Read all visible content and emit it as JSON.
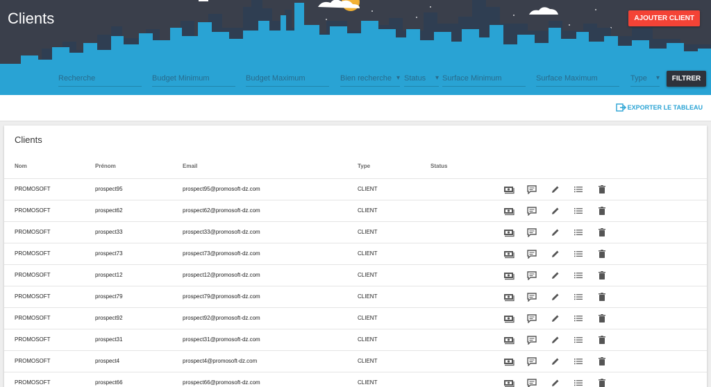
{
  "header": {
    "title": "Clients",
    "add_button": "AJOUTER CLIENT",
    "filter_button": "FILTRER",
    "filters": [
      {
        "placeholder": "Recherche",
        "type": "input"
      },
      {
        "placeholder": "Budget Minimum",
        "type": "input"
      },
      {
        "placeholder": "Budget Maximum",
        "type": "input"
      },
      {
        "placeholder": "Bien recherche",
        "type": "select"
      },
      {
        "placeholder": "Status",
        "type": "select"
      },
      {
        "placeholder": "Surface Minimum",
        "type": "input"
      },
      {
        "placeholder": "Surface Maximum",
        "type": "input"
      },
      {
        "placeholder": "Type",
        "type": "select"
      }
    ]
  },
  "toolbar": {
    "export_label": "EXPORTER LE TABLEAU"
  },
  "table": {
    "title": "Clients",
    "columns": [
      "Nom",
      "Prénom",
      "Email",
      "Type",
      "Status"
    ],
    "rows": [
      {
        "nom": "PROMOSOFT",
        "prenom": "prospect95",
        "email": "prospect95@promosoft-dz.com",
        "type": "CLIENT",
        "status": ""
      },
      {
        "nom": "PROMOSOFT",
        "prenom": "prospect62",
        "email": "prospect62@promosoft-dz.com",
        "type": "CLIENT",
        "status": ""
      },
      {
        "nom": "PROMOSOFT",
        "prenom": "prospect33",
        "email": "prospect33@promosoft-dz.com",
        "type": "CLIENT",
        "status": ""
      },
      {
        "nom": "PROMOSOFT",
        "prenom": "prospect73",
        "email": "prospect73@promosoft-dz.com",
        "type": "CLIENT",
        "status": ""
      },
      {
        "nom": "PROMOSOFT",
        "prenom": "prospect12",
        "email": "prospect12@promosoft-dz.com",
        "type": "CLIENT",
        "status": ""
      },
      {
        "nom": "PROMOSOFT",
        "prenom": "prospect79",
        "email": "prospect79@promosoft-dz.com",
        "type": "CLIENT",
        "status": ""
      },
      {
        "nom": "PROMOSOFT",
        "prenom": "prospect92",
        "email": "prospect92@promosoft-dz.com",
        "type": "CLIENT",
        "status": ""
      },
      {
        "nom": "PROMOSOFT",
        "prenom": "prospect31",
        "email": "prospect31@promosoft-dz.com",
        "type": "CLIENT",
        "status": ""
      },
      {
        "nom": "PROMOSOFT",
        "prenom": "prospect4",
        "email": "prospect4@promosoft-dz.com",
        "type": "CLIENT",
        "status": ""
      },
      {
        "nom": "PROMOSOFT",
        "prenom": "prospect66",
        "email": "prospect66@promosoft-dz.com",
        "type": "CLIENT",
        "status": ""
      }
    ],
    "row_actions": [
      "money-icon",
      "comment-icon",
      "edit-icon",
      "list-icon",
      "delete-icon"
    ]
  },
  "colors": {
    "header_sky": "#3a3f4b",
    "skyline": "#29a3d4",
    "accent_red": "#f44336",
    "filter_button": "#2e323b",
    "link_blue": "#29a3d4",
    "icon_grey": "#555555"
  }
}
